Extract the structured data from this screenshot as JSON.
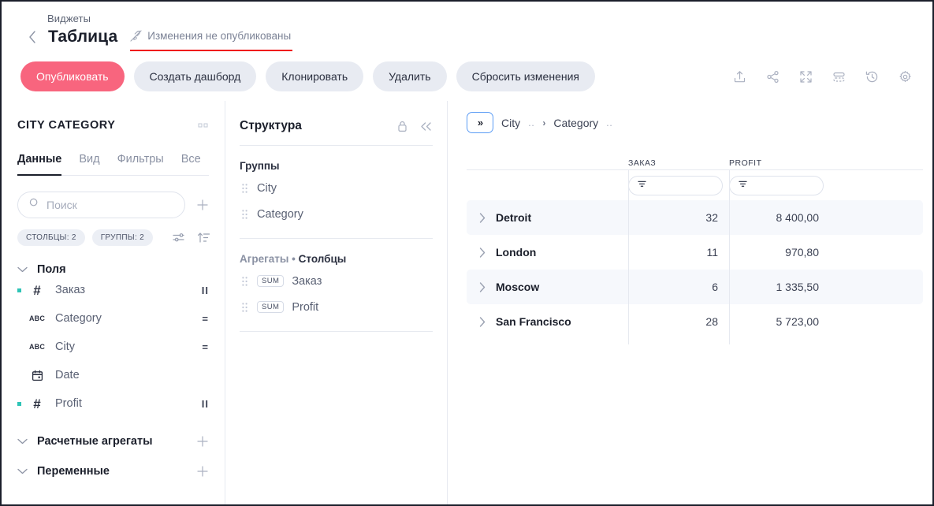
{
  "header": {
    "breadcrumb_parent": "Виджеты",
    "title": "Таблица",
    "back_icon": "chevron-left-icon",
    "status_icon": "rocket-off-icon",
    "status_text": "Изменения не опубликованы",
    "buttons": [
      {
        "label": "Опубликовать",
        "primary": true
      },
      {
        "label": "Создать дашборд",
        "primary": false
      },
      {
        "label": "Клонировать",
        "primary": false
      },
      {
        "label": "Удалить",
        "primary": false
      },
      {
        "label": "Сбросить изменения",
        "primary": false
      }
    ],
    "tools": [
      {
        "name": "upload-icon"
      },
      {
        "name": "share-icon"
      },
      {
        "name": "fullscreen-icon"
      },
      {
        "name": "layout-icon"
      },
      {
        "name": "history-icon"
      },
      {
        "name": "gear-icon"
      }
    ]
  },
  "fields_panel": {
    "title": "CITY CATEGORY",
    "more_icon": "more-dots-icon",
    "tabs": [
      {
        "label": "Данные",
        "active": true
      },
      {
        "label": "Вид",
        "active": false
      },
      {
        "label": "Фильтры",
        "active": false
      },
      {
        "label": "Все",
        "active": false
      }
    ],
    "search": {
      "placeholder": "Поиск",
      "value": "",
      "icon": "search-icon"
    },
    "add_icon": "plus-icon",
    "chips": [
      {
        "label": "СТОЛБЦЫ: 2"
      },
      {
        "label": "ГРУППЫ: 2"
      }
    ],
    "chip_icons": [
      {
        "name": "settings-sliders-icon"
      },
      {
        "name": "sort-asc-icon"
      }
    ],
    "sections": [
      {
        "label": "Поля",
        "caret": "chevron-down-icon",
        "tail_icon": ""
      },
      {
        "label": "Расчетные агрегаты",
        "caret": "chevron-down-icon",
        "tail_icon": "plus-icon"
      },
      {
        "label": "Переменные",
        "caret": "chevron-down-icon",
        "tail_icon": "plus-icon"
      }
    ],
    "fields": [
      {
        "name": "Заказ",
        "type": "#",
        "dot": true,
        "badge": "II"
      },
      {
        "name": "Category",
        "type": "ABC",
        "dot": false,
        "badge": "="
      },
      {
        "name": "City",
        "type": "ABC",
        "dot": false,
        "badge": "="
      },
      {
        "name": "Date",
        "type": "cal",
        "dot": false,
        "badge": ""
      },
      {
        "name": "Profit",
        "type": "#",
        "dot": true,
        "badge": "II"
      }
    ]
  },
  "structure_panel": {
    "title": "Структура",
    "lock_icon": "lock-icon",
    "collapse_icon": "chevrons-left-icon",
    "groups_label": "Группы",
    "groups": [
      {
        "name": "City"
      },
      {
        "name": "Category"
      }
    ],
    "aggregates_label_1": "Агрегаты",
    "aggregates_sep": "•",
    "aggregates_label_2": "Столбцы",
    "aggregates": [
      {
        "tag": "SUM",
        "name": "Заказ"
      },
      {
        "tag": "SUM",
        "name": "Profit"
      }
    ]
  },
  "table_panel": {
    "expand_button": "»",
    "breadcrumbs": [
      {
        "label": "City",
        "dots": ".."
      },
      {
        "label": "Category",
        "dots": ".."
      }
    ],
    "breadcrumb_sep": "›",
    "columns": [
      {
        "label": "",
        "key": "name"
      },
      {
        "label": "ЗАКАЗ",
        "key": "order"
      },
      {
        "label": "PROFIT",
        "key": "profit"
      }
    ],
    "filter_icon": "filter-icon",
    "row_caret_icon": "chevron-right-icon",
    "rows": [
      {
        "name": "Detroit",
        "order": "32",
        "profit": "8 400,00",
        "alt": true
      },
      {
        "name": "London",
        "order": "11",
        "profit": "970,80",
        "alt": false
      },
      {
        "name": "Moscow",
        "order": "6",
        "profit": "1 335,50",
        "alt": true
      },
      {
        "name": "San Francisco",
        "order": "28",
        "profit": "5 723,00",
        "alt": false
      }
    ]
  },
  "colors": {
    "primary": "#f8657e",
    "accent_dot": "#2ec4b6",
    "alert_underline": "#f01b1b",
    "focus_border": "#5b9cf5",
    "row_alt": "#f6f8fc"
  }
}
